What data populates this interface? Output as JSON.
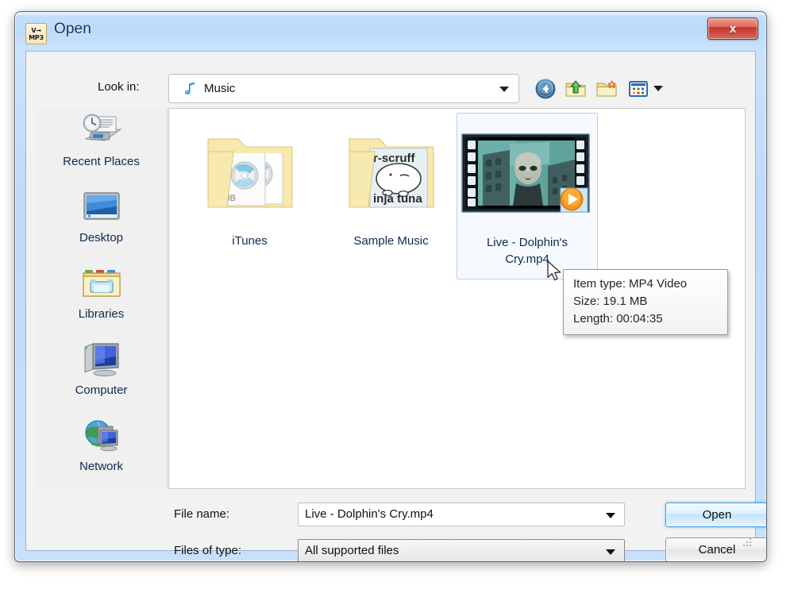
{
  "window": {
    "title": "Open",
    "app_icon_top": "V→",
    "app_icon_bottom": "MP3",
    "close_label": "x"
  },
  "toolbar": {
    "lookin_label": "Look in:",
    "lookin_value": "Music",
    "lookin_icon": "music-note-icon",
    "buttons": [
      {
        "name": "back-button",
        "tip": "Back"
      },
      {
        "name": "up-folder-button",
        "tip": "Up One Level"
      },
      {
        "name": "new-folder-button",
        "tip": "Create New Folder"
      },
      {
        "name": "views-button",
        "tip": "Views"
      }
    ]
  },
  "sidebar": {
    "items": [
      {
        "label": "Recent Places",
        "icon": "recent-places-icon"
      },
      {
        "label": "Desktop",
        "icon": "desktop-icon"
      },
      {
        "label": "Libraries",
        "icon": "libraries-icon"
      },
      {
        "label": "Computer",
        "icon": "computer-icon"
      },
      {
        "label": "Network",
        "icon": "network-icon"
      }
    ]
  },
  "filelist": {
    "items": [
      {
        "label": "iTunes",
        "kind": "folder",
        "selected": false
      },
      {
        "label": "Sample Music",
        "kind": "folder",
        "selected": false
      },
      {
        "label": "Live - Dolphin's Cry.mp4",
        "kind": "video",
        "selected": true
      }
    ]
  },
  "tooltip": {
    "line1": "Item type: MP4 Video",
    "line2": "Size: 19.1 MB",
    "line3": "Length: 00:04:35"
  },
  "form": {
    "filename_label": "File name:",
    "filename_value": "Live - Dolphin's Cry.mp4",
    "filetype_label": "Files of type:",
    "filetype_value": "All supported files",
    "open_label": "Open",
    "cancel_label": "Cancel"
  },
  "colors": {
    "titlebar": "#bddbfa",
    "close_button": "#c6342a",
    "selection_border": "#b5d2ef",
    "selection_fill": "#f6fafe",
    "default_button_border": "#3c9ede",
    "play_badge": "#f08a12",
    "folder": "#f5e5a3",
    "label_text": "#0b2a50"
  }
}
